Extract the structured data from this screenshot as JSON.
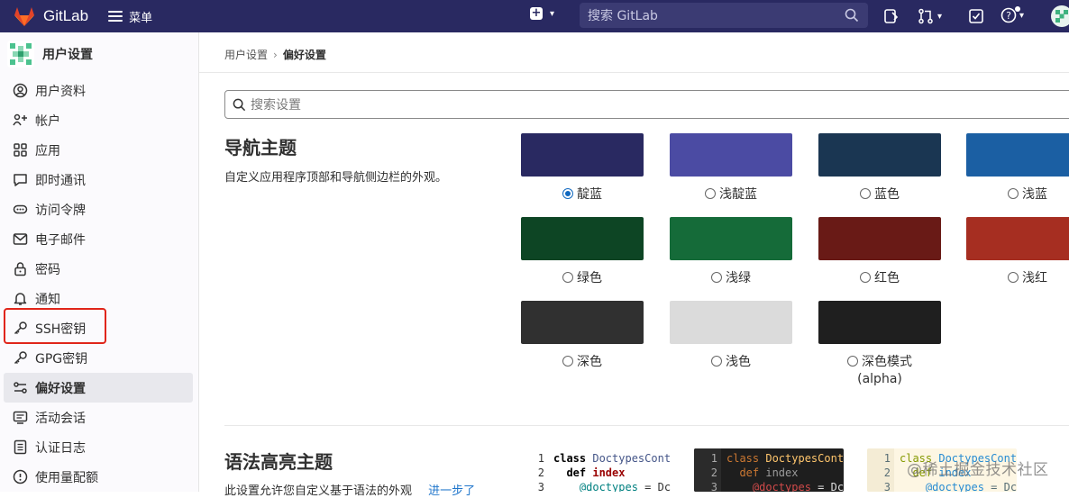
{
  "topbar": {
    "brand": "GitLab",
    "menu_label": "菜单",
    "search_placeholder": "搜索 GitLab"
  },
  "sidebar": {
    "title": "用户设置",
    "items": [
      {
        "label": "用户资料",
        "icon": "user-icon"
      },
      {
        "label": "帐户",
        "icon": "account-icon"
      },
      {
        "label": "应用",
        "icon": "applications-icon"
      },
      {
        "label": "即时通讯",
        "icon": "chat-icon"
      },
      {
        "label": "访问令牌",
        "icon": "token-icon"
      },
      {
        "label": "电子邮件",
        "icon": "mail-icon"
      },
      {
        "label": "密码",
        "icon": "lock-icon"
      },
      {
        "label": "通知",
        "icon": "bell-icon"
      },
      {
        "label": "SSH密钥",
        "icon": "key-icon"
      },
      {
        "label": "GPG密钥",
        "icon": "key-icon"
      },
      {
        "label": "偏好设置",
        "icon": "preferences-icon",
        "active": true
      },
      {
        "label": "活动会话",
        "icon": "sessions-icon"
      },
      {
        "label": "认证日志",
        "icon": "log-icon"
      },
      {
        "label": "使用量配额",
        "icon": "quota-icon"
      }
    ]
  },
  "breadcrumb": {
    "parent": "用户设置",
    "current": "偏好设置"
  },
  "settings_search_placeholder": "搜索设置",
  "nav_theme": {
    "title": "导航主题",
    "description": "自定义应用程序顶部和导航侧边栏的外观。",
    "themes": [
      {
        "label": "靛蓝",
        "color": "#292961",
        "selected": true
      },
      {
        "label": "浅靛蓝",
        "color": "#4b4ba3"
      },
      {
        "label": "蓝色",
        "color": "#1a3652"
      },
      {
        "label": "浅蓝",
        "color": "#1b5fa3"
      },
      {
        "label": "绿色",
        "color": "#0d4524"
      },
      {
        "label": "浅绿",
        "color": "#156b39"
      },
      {
        "label": "红色",
        "color": "#691a16"
      },
      {
        "label": "浅红",
        "color": "#a62e21"
      },
      {
        "label": "深色",
        "color": "#303030"
      },
      {
        "label": "浅色",
        "color": "#dbdbdb"
      },
      {
        "label": "深色模式",
        "label2": "(alpha)",
        "color": "#1f1f1f"
      }
    ]
  },
  "syntax_theme": {
    "title": "语法高亮主题",
    "description": "此设置允许您自定义基于语法的外观",
    "link": "进一步了",
    "previews": [
      {
        "theme": "light",
        "lines": [
          "class DoctypesCont",
          "  def index",
          "    @doctypes = Dc"
        ]
      },
      {
        "theme": "dark",
        "lines": [
          "class DoctypesCont",
          "  def index",
          "    @doctypes = Dc"
        ]
      },
      {
        "theme": "solarized",
        "lines": [
          "class DoctypesCont",
          "  def index",
          "    @doctypes = Dc"
        ]
      }
    ],
    "line_numbers": [
      "1",
      "2",
      "3"
    ]
  },
  "watermark": "@稀土掘金技术社区"
}
